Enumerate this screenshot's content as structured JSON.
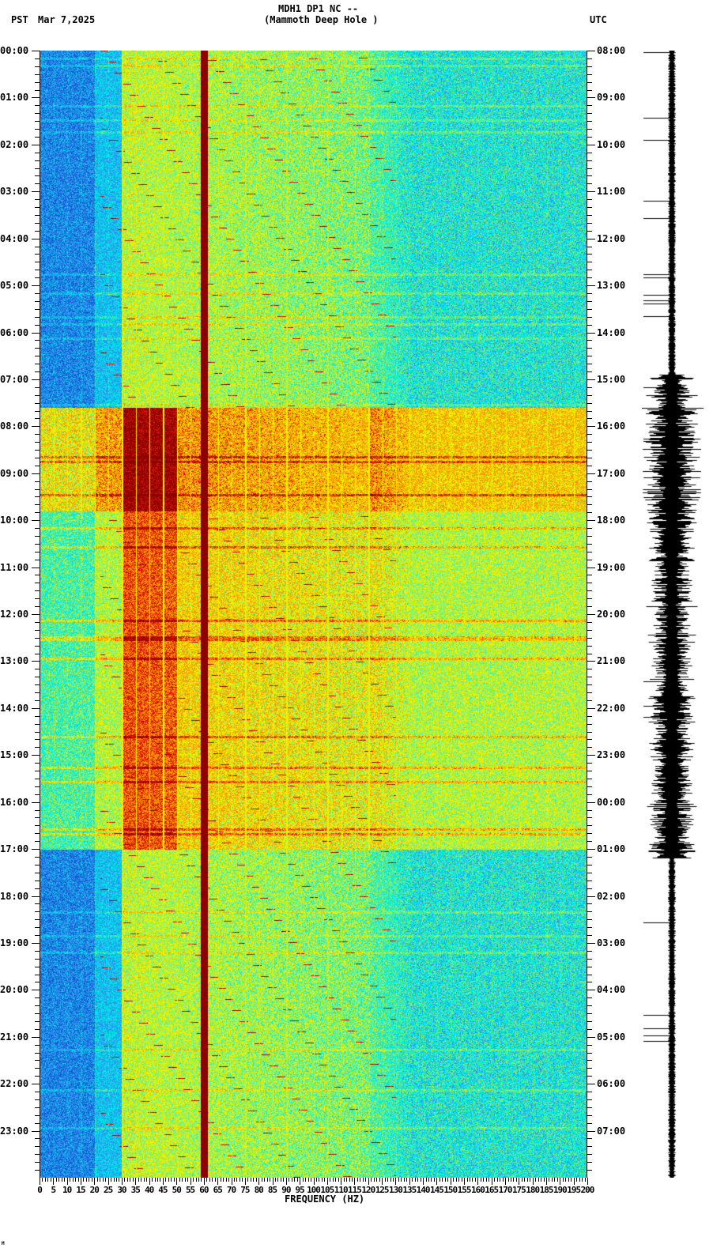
{
  "header": {
    "station": "MDH1 DP1 NC --",
    "site": "(Mammoth Deep Hole )",
    "left_tz": "PST",
    "date": "Mar 7,2025",
    "right_tz": "UTC"
  },
  "chart_data": {
    "type": "heatmap",
    "title": "MDH1 DP1 NC --",
    "subtitle": "(Mammoth Deep Hole )",
    "xlabel": "FREQUENCY (HZ)",
    "xlim": [
      0,
      200
    ],
    "x_ticks": [
      "0",
      "5",
      "10",
      "15",
      "20",
      "25",
      "30",
      "35",
      "40",
      "45",
      "50",
      "55",
      "60",
      "65",
      "70",
      "75",
      "80",
      "85",
      "90",
      "95",
      "100",
      "105",
      "110",
      "115",
      "120",
      "125",
      "130",
      "135",
      "140",
      "145",
      "150",
      "155",
      "160",
      "165",
      "170",
      "175",
      "180",
      "185",
      "190",
      "195",
      "200"
    ],
    "ylim_hours": [
      0,
      24
    ],
    "y_ticks_left_pst": [
      "00:00",
      "01:00",
      "02:00",
      "03:00",
      "04:00",
      "05:00",
      "06:00",
      "07:00",
      "08:00",
      "09:00",
      "10:00",
      "11:00",
      "12:00",
      "13:00",
      "14:00",
      "15:00",
      "16:00",
      "17:00",
      "18:00",
      "19:00",
      "20:00",
      "21:00",
      "22:00",
      "23:00"
    ],
    "y_ticks_right_utc": [
      "08:00",
      "09:00",
      "10:00",
      "11:00",
      "12:00",
      "13:00",
      "14:00",
      "15:00",
      "16:00",
      "17:00",
      "18:00",
      "19:00",
      "20:00",
      "21:00",
      "22:00",
      "23:00",
      "00:00",
      "01:00",
      "02:00",
      "03:00",
      "04:00",
      "05:00",
      "06:00",
      "07:00"
    ],
    "persistent_line_hz": 60,
    "high_energy_period_pst_hours": [
      7.6,
      17.0
    ],
    "colors": {
      "low": "#1e6fd8",
      "mid": "#00e8e0",
      "high": "#f0f000",
      "peak": "#8b0000"
    }
  },
  "footer": {
    "mark": "M"
  }
}
